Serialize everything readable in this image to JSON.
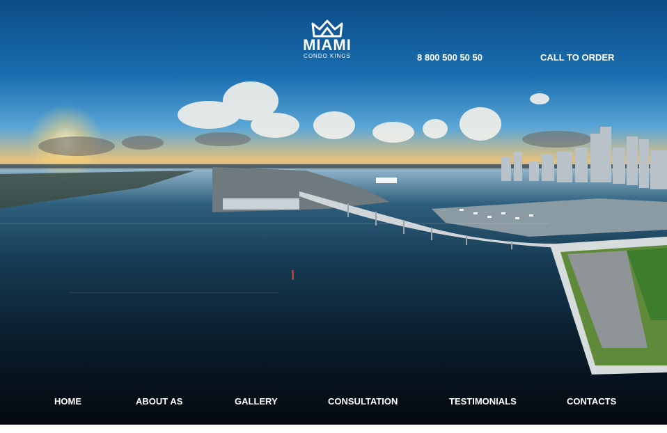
{
  "brand": {
    "name": "MIAMI",
    "subtitle": "CONDO KINGS",
    "logo_icon": "crown-icon"
  },
  "header": {
    "phone": "8 800 500 50 50",
    "cta_label": "CALL TO ORDER"
  },
  "nav": {
    "items": [
      {
        "label": "HOME"
      },
      {
        "label": "ABOUT AS"
      },
      {
        "label": "GALLERY"
      },
      {
        "label": "CONSULTATION"
      },
      {
        "label": "TESTIMONIALS"
      },
      {
        "label": "CONTACTS"
      }
    ]
  },
  "colors": {
    "text": "#ffffff",
    "sky_top": "#0b4b86",
    "water_dark": "#04090f",
    "sun": "#ffd678"
  }
}
